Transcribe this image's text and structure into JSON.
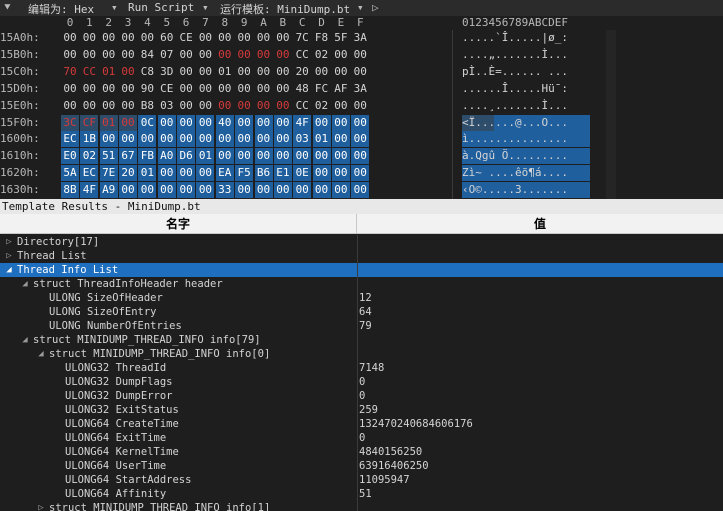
{
  "toolbar": {
    "edit_as_label": "编辑为: Hex",
    "run_script_label": "Run Script",
    "template_label": "运行模板: MiniDump.bt"
  },
  "hex": {
    "col_headers": [
      "0",
      "1",
      "2",
      "3",
      "4",
      "5",
      "6",
      "7",
      "8",
      "9",
      "A",
      "B",
      "C",
      "D",
      "E",
      "F"
    ],
    "ascii_header": "0123456789ABCDEF",
    "rows": [
      {
        "addr": "15A0h:",
        "bytes": [
          "00",
          "00",
          "00",
          "00",
          "00",
          "60",
          "CE",
          "00",
          "00",
          "00",
          "00",
          "00",
          "7C",
          "F8",
          "5F",
          "3A"
        ],
        "red": [],
        "ascii": ".....`Î.....|ø_:"
      },
      {
        "addr": "15B0h:",
        "bytes": [
          "00",
          "00",
          "00",
          "00",
          "84",
          "07",
          "00",
          "00",
          "00",
          "00",
          "00",
          "00",
          "CC",
          "02",
          "00",
          "00"
        ],
        "red": [
          8,
          9,
          10,
          11
        ],
        "ascii": "....„.......Ì..."
      },
      {
        "addr": "15C0h:",
        "bytes": [
          "70",
          "CC",
          "01",
          "00",
          "C8",
          "3D",
          "00",
          "00",
          "01",
          "00",
          "00",
          "00",
          "20",
          "00",
          "00",
          "00"
        ],
        "red": [
          0,
          1,
          2,
          3
        ],
        "ascii": "pÌ..È=...... ..."
      },
      {
        "addr": "15D0h:",
        "bytes": [
          "00",
          "00",
          "00",
          "00",
          "90",
          "CE",
          "00",
          "00",
          "00",
          "00",
          "00",
          "00",
          "48",
          "FC",
          "AF",
          "3A"
        ],
        "red": [],
        "ascii": "......Î.....Hü¯:"
      },
      {
        "addr": "15E0h:",
        "bytes": [
          "00",
          "00",
          "00",
          "00",
          "B8",
          "03",
          "00",
          "00",
          "00",
          "00",
          "00",
          "00",
          "CC",
          "02",
          "00",
          "00"
        ],
        "red": [
          8,
          9,
          10,
          11
        ],
        "ascii": "....¸.......Ì..."
      },
      {
        "addr": "15F0h:",
        "bytes": [
          "3C",
          "CF",
          "01",
          "00",
          "0C",
          "00",
          "00",
          "00",
          "40",
          "00",
          "00",
          "00",
          "4F",
          "00",
          "00",
          "00"
        ],
        "red": [
          0,
          1,
          2,
          3
        ],
        "ascii": "<Ï......@...O..."
      },
      {
        "addr": "1600h:",
        "bytes": [
          "EC",
          "1B",
          "00",
          "00",
          "00",
          "00",
          "00",
          "00",
          "00",
          "00",
          "00",
          "00",
          "03",
          "01",
          "00",
          "00"
        ],
        "red": [],
        "ascii": "ì..............."
      },
      {
        "addr": "1610h:",
        "bytes": [
          "E0",
          "02",
          "51",
          "67",
          "FB",
          "A0",
          "D6",
          "01",
          "00",
          "00",
          "00",
          "00",
          "00",
          "00",
          "00",
          "00"
        ],
        "red": [],
        "ascii": "à.Qgû Ö........."
      },
      {
        "addr": "1620h:",
        "bytes": [
          "5A",
          "EC",
          "7E",
          "20",
          "01",
          "00",
          "00",
          "00",
          "EA",
          "F5",
          "B6",
          "E1",
          "0E",
          "00",
          "00",
          "00"
        ],
        "red": [],
        "ascii": "Zì~ ....êõ¶á...."
      },
      {
        "addr": "1630h:",
        "bytes": [
          "8B",
          "4F",
          "A9",
          "00",
          "00",
          "00",
          "00",
          "00",
          "33",
          "00",
          "00",
          "00",
          "00",
          "00",
          "00",
          "00"
        ],
        "red": [],
        "ascii": "‹O©.....3......."
      }
    ]
  },
  "template_results": {
    "title": "Template Results - MiniDump.bt",
    "col_name": "名字",
    "col_value": "值",
    "rows": [
      {
        "indent": 0,
        "toggle": "▷",
        "type": "",
        "name": "Directory[17]",
        "value": "",
        "selected": false
      },
      {
        "indent": 0,
        "toggle": "▷",
        "type": "",
        "name": "Thread List",
        "value": "",
        "selected": false
      },
      {
        "indent": 0,
        "toggle": "◢",
        "type": "",
        "name": "Thread Info List",
        "value": "",
        "selected": true
      },
      {
        "indent": 1,
        "toggle": "◢",
        "type": "struct ThreadInfoHeader",
        "name": "header",
        "value": "",
        "selected": false
      },
      {
        "indent": 2,
        "toggle": "",
        "type": "ULONG",
        "name": "SizeOfHeader",
        "value": "12",
        "selected": false
      },
      {
        "indent": 2,
        "toggle": "",
        "type": "ULONG",
        "name": "SizeOfEntry",
        "value": "64",
        "selected": false
      },
      {
        "indent": 2,
        "toggle": "",
        "type": "ULONG",
        "name": "NumberOfEntries",
        "value": "79",
        "selected": false
      },
      {
        "indent": 1,
        "toggle": "◢",
        "type": "struct MINIDUMP_THREAD_INFO",
        "name": "info[79]",
        "value": "",
        "selected": false
      },
      {
        "indent": 2,
        "toggle": "◢",
        "type": "struct MINIDUMP_THREAD_INFO",
        "name": "info[0]",
        "value": "",
        "selected": false
      },
      {
        "indent": 3,
        "toggle": "",
        "type": "ULONG32",
        "name": "ThreadId",
        "value": "7148",
        "selected": false
      },
      {
        "indent": 3,
        "toggle": "",
        "type": "ULONG32",
        "name": "DumpFlags",
        "value": "0",
        "selected": false
      },
      {
        "indent": 3,
        "toggle": "",
        "type": "ULONG32",
        "name": "DumpError",
        "value": "0",
        "selected": false
      },
      {
        "indent": 3,
        "toggle": "",
        "type": "ULONG32",
        "name": "ExitStatus",
        "value": "259",
        "selected": false
      },
      {
        "indent": 3,
        "toggle": "",
        "type": "ULONG64",
        "name": "CreateTime",
        "value": "132470240684606176",
        "selected": false
      },
      {
        "indent": 3,
        "toggle": "",
        "type": "ULONG64",
        "name": "ExitTime",
        "value": "0",
        "selected": false
      },
      {
        "indent": 3,
        "toggle": "",
        "type": "ULONG64",
        "name": "KernelTime",
        "value": "4840156250",
        "selected": false
      },
      {
        "indent": 3,
        "toggle": "",
        "type": "ULONG64",
        "name": "UserTime",
        "value": "63916406250",
        "selected": false
      },
      {
        "indent": 3,
        "toggle": "",
        "type": "ULONG64",
        "name": "StartAddress",
        "value": "11095947",
        "selected": false
      },
      {
        "indent": 3,
        "toggle": "",
        "type": "ULONG64",
        "name": "Affinity",
        "value": "51",
        "selected": false
      },
      {
        "indent": 2,
        "toggle": "▷",
        "type": "struct MINIDUMP_THREAD_INFO",
        "name": "info[1]",
        "value": "",
        "selected": false
      }
    ]
  },
  "colors": {
    "background": "#1e1e1e",
    "selection": "#1f5f9e",
    "tree_selection": "#1f6fc0",
    "template_bytes": "#d63a3a"
  }
}
